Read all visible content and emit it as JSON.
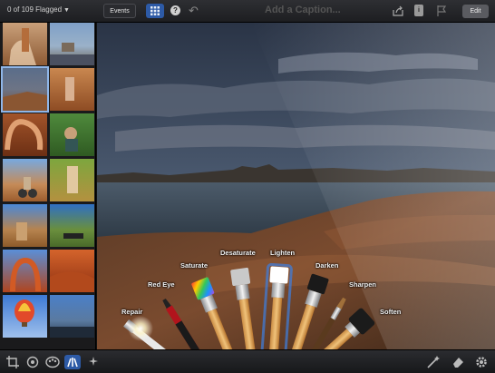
{
  "topbar": {
    "filter_label": "0 of 109 Flagged",
    "events_label": "Events",
    "caption_placeholder": "Add a Caption...",
    "edit_label": "Edit",
    "info_label": "i"
  },
  "brushes": {
    "repair": "Repair",
    "red_eye": "Red Eye",
    "saturate": "Saturate",
    "desaturate": "Desaturate",
    "lighten": "Lighten",
    "darken": "Darken",
    "sharpen": "Sharpen",
    "soften": "Soften"
  },
  "icons": {
    "grid": "grid-icon",
    "help": "help-icon",
    "undo": "undo-icon",
    "share": "share-icon",
    "flag": "flag-icon",
    "crop": "crop-icon",
    "rotate": "rotate-icon",
    "palette": "palette-icon",
    "brushes": "brushes-icon",
    "effects": "effects-icon",
    "auto_enhance": "auto-enhance-icon",
    "eraser": "eraser-icon",
    "settings": "gear-icon"
  },
  "colors": {
    "accent": "#2d5aa6",
    "selected_thumb": "#8fb6e8"
  }
}
